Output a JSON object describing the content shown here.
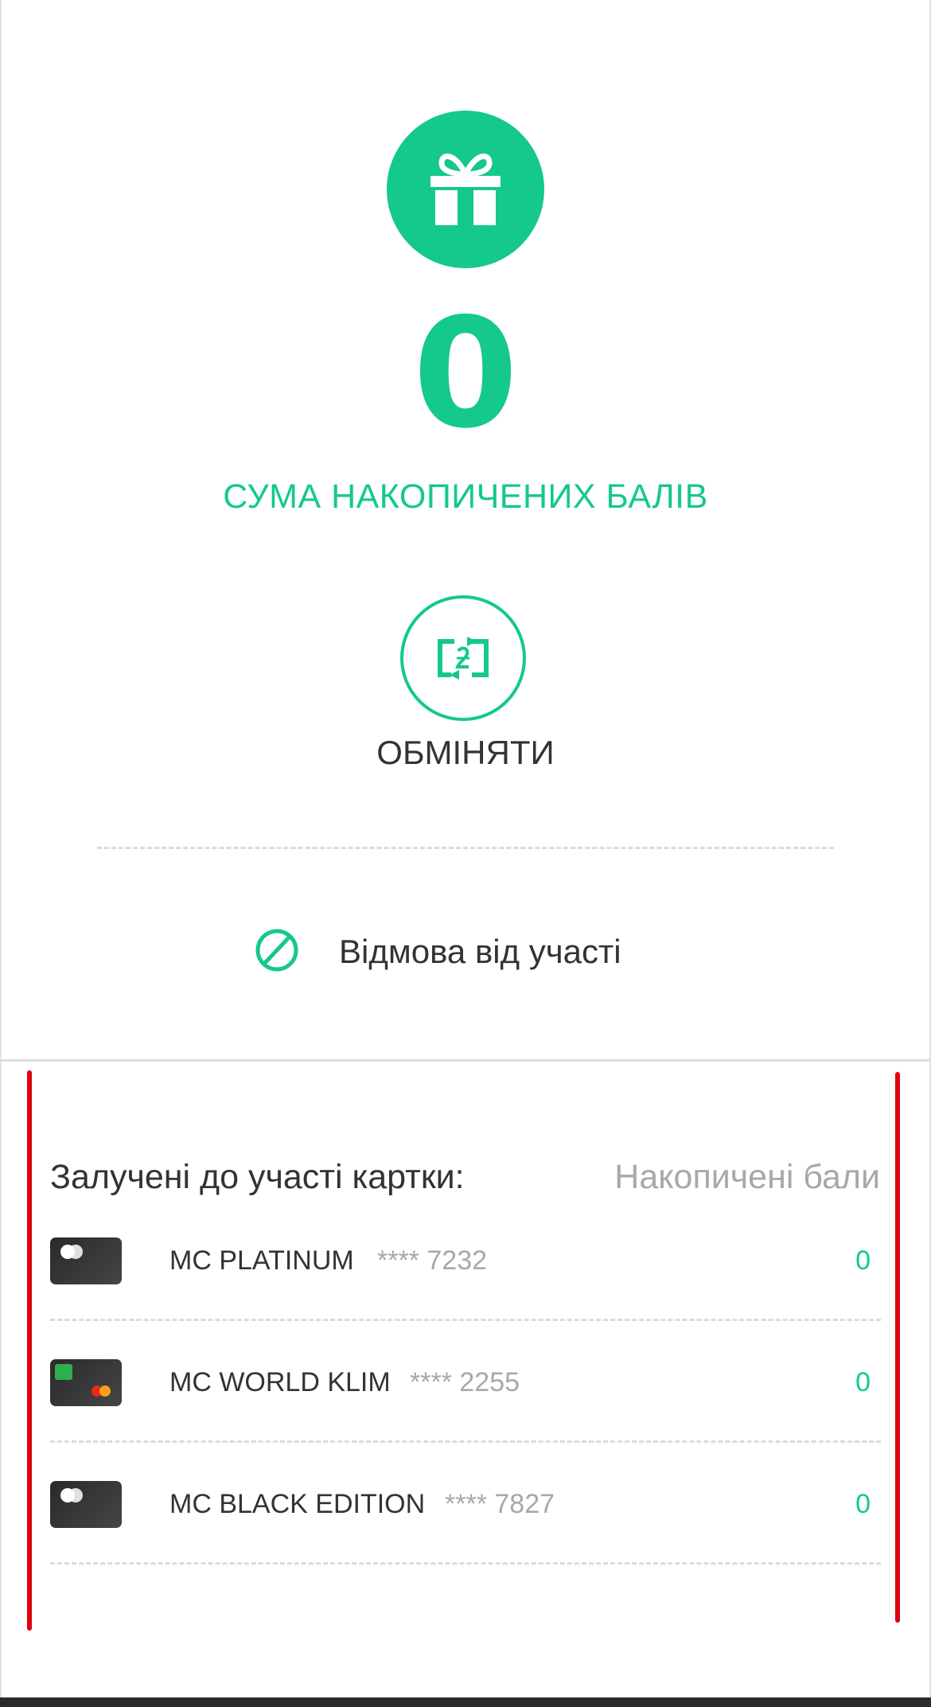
{
  "loyalty": {
    "points_total": "0",
    "points_caption": "СУМА НАКОПИЧЕНИХ БАЛІВ",
    "exchange_label": "ОБМІНЯТИ",
    "optout_label": "Відмова від участі"
  },
  "cards_section": {
    "heading": "Залучені до участі картки:",
    "points_heading": "Накопичені бали",
    "cards": [
      {
        "name": "MC PLATINUM",
        "number": "**** 7232",
        "points": "0"
      },
      {
        "name": "MC WORLD KLIM",
        "number": "**** 2255",
        "points": "0"
      },
      {
        "name": "MC BLACK EDITION",
        "number": "**** 7827",
        "points": "0"
      }
    ]
  },
  "icons": {
    "top": "gift-icon",
    "exchange": "currency-exchange-icon",
    "optout": "prohibited-icon"
  },
  "colors": {
    "accent": "#14c88e",
    "highlight": "#e0000f",
    "text": "#333333",
    "muted": "#a8a8a8"
  }
}
